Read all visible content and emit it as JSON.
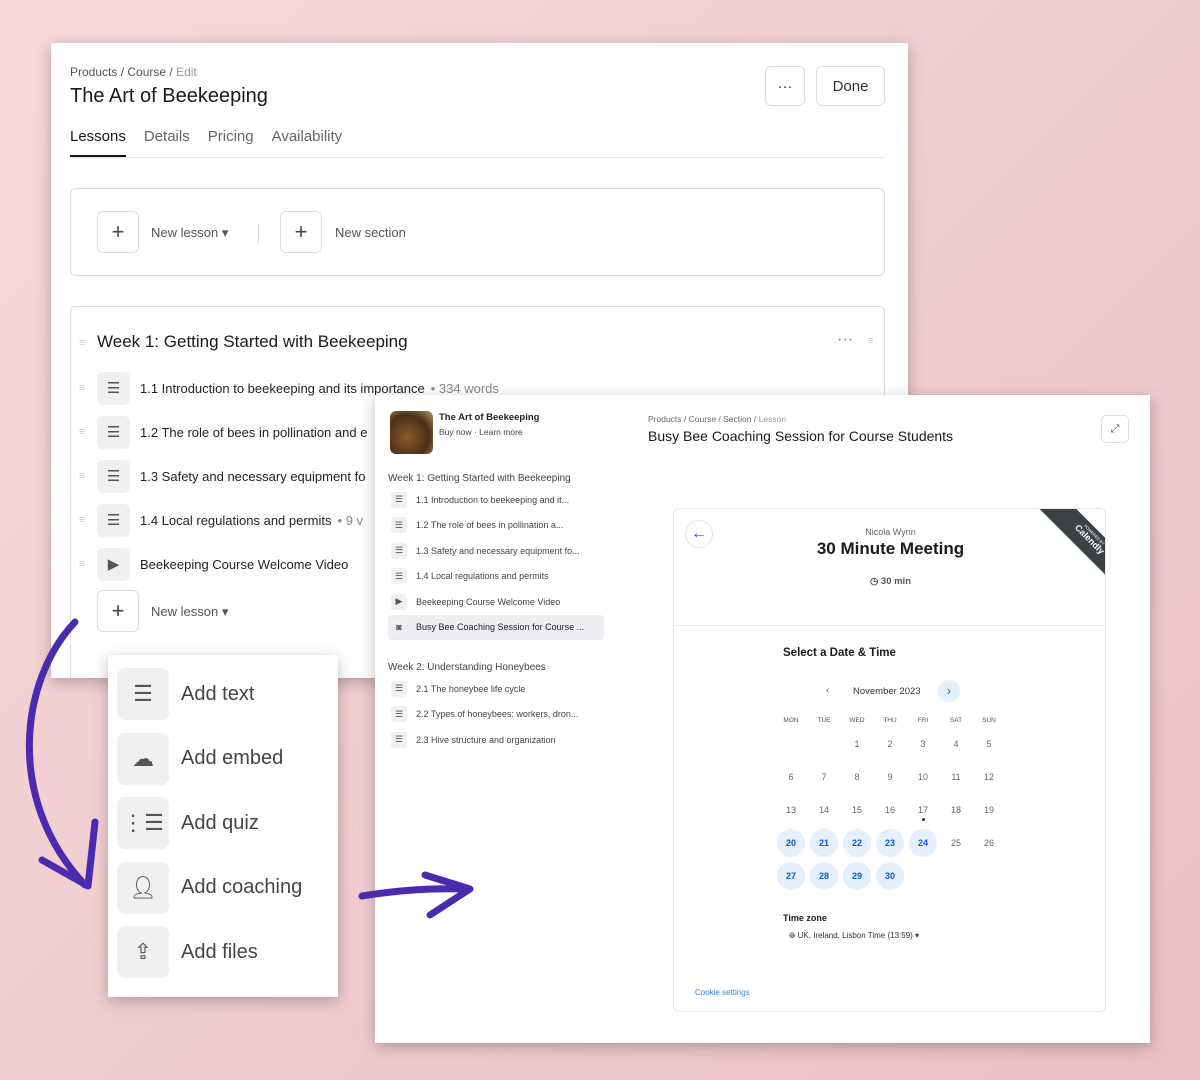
{
  "editor": {
    "breadcrumb": [
      "Products",
      "Course",
      "Edit"
    ],
    "title": "The Art of Beekeeping",
    "more_label": "···",
    "done_label": "Done",
    "tabs": [
      "Lessons",
      "Details",
      "Pricing",
      "Availability"
    ],
    "new_lesson": "New lesson",
    "new_section": "New section",
    "section_title": "Week 1: Getting Started with Beekeeping",
    "lessons": [
      {
        "title": "1.1 Introduction to beekeeping and its importance",
        "meta": "334 words",
        "icon": "text-icon"
      },
      {
        "title": "1.2 The role of bees in pollination and e",
        "meta": "",
        "icon": "text-icon"
      },
      {
        "title": "1.3 Safety and necessary equipment fo",
        "meta": "",
        "icon": "text-icon"
      },
      {
        "title": "1.4 Local regulations and permits",
        "meta": "9 v",
        "icon": "text-icon"
      },
      {
        "title": "Beekeeping Course Welcome Video",
        "meta": "",
        "icon": "video-icon"
      }
    ]
  },
  "add_menu": [
    {
      "label": "Add text",
      "icon": "text-icon"
    },
    {
      "label": "Add embed",
      "icon": "cloud-icon"
    },
    {
      "label": "Add quiz",
      "icon": "list-icon"
    },
    {
      "label": "Add coaching",
      "icon": "user-icon"
    },
    {
      "label": "Add files",
      "icon": "file-upload-icon"
    }
  ],
  "preview": {
    "course_title": "The Art of Beekeeping",
    "buy_now": "Buy now",
    "learn_more": "Learn more",
    "breadcrumb": [
      "Products",
      "Course",
      "Section",
      "Lesson"
    ],
    "lesson_title": "Busy Bee Coaching Session for Course Students",
    "sections": [
      {
        "title": "Week 1: Getting Started with Beekeeping",
        "items": [
          {
            "label": "1.1 Introduction to beekeeping and it...",
            "icon": "text-icon"
          },
          {
            "label": "1.2 The role of bees in pollination a...",
            "icon": "text-icon"
          },
          {
            "label": "1.3 Safety and necessary equipment fo...",
            "icon": "text-icon"
          },
          {
            "label": "1.4 Local regulations and permits",
            "icon": "text-icon"
          },
          {
            "label": "Beekeeping Course Welcome Video",
            "icon": "video-icon"
          },
          {
            "label": "Busy Bee Coaching Session for Course ...",
            "icon": "coaching-icon",
            "selected": true
          }
        ]
      },
      {
        "title": "Week 2: Understanding Honeybees",
        "items": [
          {
            "label": "2.1 The honeybee life cycle",
            "icon": "text-icon"
          },
          {
            "label": "2.2 Types of honeybees: workers, dron...",
            "icon": "text-icon"
          },
          {
            "label": "2.3 Hive structure and organization",
            "icon": "text-icon"
          }
        ]
      }
    ],
    "calendly": {
      "host": "Nicola Wynn",
      "event": "30 Minute Meeting",
      "duration": "30 min",
      "ribbon_small": "POWERED BY",
      "ribbon": "Calendly",
      "select_heading": "Select a Date & Time",
      "month": "November 2023",
      "weekdays": [
        "MON",
        "TUE",
        "WED",
        "THU",
        "FRI",
        "SAT",
        "SUN"
      ],
      "first_weekday_index": 2,
      "days_in_month": 30,
      "available_days": [
        20,
        21,
        22,
        23,
        24,
        27,
        28,
        29,
        30
      ],
      "today": 17,
      "timezone_label": "Time zone",
      "timezone": "UK, Ireland, Lisbon Time (13:59)",
      "cookie": "Cookie settings",
      "accent": "#0b5ad1"
    }
  },
  "colors": {
    "arrow": "#4a2bb0"
  }
}
